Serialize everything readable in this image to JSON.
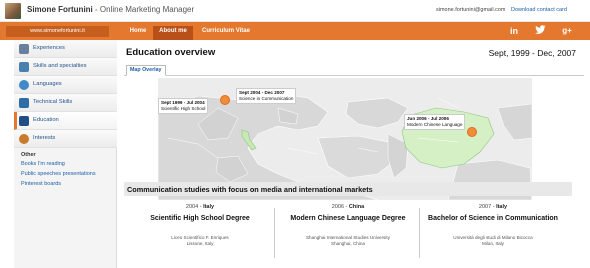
{
  "header": {
    "name": "Simone Fortunini",
    "separator": " - ",
    "role": "Online Marketing Manager",
    "email": "simone.fortunini@gmail.com",
    "download_link": "Download contact card"
  },
  "nav": {
    "url_label": "www.simonefortunini.it",
    "items": [
      {
        "label": "Home"
      },
      {
        "label": "About me"
      },
      {
        "label": "Curriculum Vitae"
      }
    ],
    "social": [
      {
        "label": "in",
        "icon": "linkedin-icon"
      },
      {
        "label": "t",
        "icon": "twitter-icon"
      },
      {
        "label": "g+",
        "icon": "google-plus-icon"
      }
    ],
    "accent": "#e5782f"
  },
  "sidebar": {
    "items": [
      {
        "label": "Experiences",
        "icon": "experiences-icon",
        "color": "#6a7f9b"
      },
      {
        "label": "Skills and specialties",
        "icon": "skills-icon",
        "color": "#4a7fb0"
      },
      {
        "label": "Languages",
        "icon": "languages-icon",
        "color": "#3f8ac7"
      },
      {
        "label": "Technical Skills",
        "icon": "technical-skills-icon",
        "color": "#2f6da8"
      },
      {
        "label": "Education",
        "icon": "education-icon",
        "color": "#1f4f86"
      },
      {
        "label": "Interests",
        "icon": "interests-icon",
        "color": "#c97b2b"
      }
    ],
    "other_title": "Other",
    "other_links": [
      {
        "label": "Books I'm reading"
      },
      {
        "label": "Public speeches presentations"
      },
      {
        "label": "Pinterest boards"
      }
    ]
  },
  "main": {
    "title": "Education overview",
    "date_range": "Sept, 1999 - Dec, 2007",
    "tab": "Map Overlay",
    "map": {
      "callouts": [
        {
          "dates": "Sept 1999 - Jul 2004",
          "desc": "Scientific High School"
        },
        {
          "dates": "Sept 2004 - Dec 2007",
          "desc": "Science in Communication"
        },
        {
          "dates": "Jun 2006 - Jul 2006",
          "desc": "Modern Chinese Language"
        }
      ]
    },
    "section_title": "Communication studies with focus on media and international markets",
    "education": [
      {
        "year": "2004",
        "country": "Italy",
        "degree": "Scientific High School Degree",
        "school": "Liceo Scientifico F. Enriques",
        "city": "Lissone, Italy"
      },
      {
        "year": "2006",
        "country": "China",
        "degree": "Modern Chinese Language Degree",
        "school": "Shanghai International Studies University",
        "city": "Shanghai, China"
      },
      {
        "year": "2007",
        "country": "Italy",
        "degree": "Bachelor of Science in Communication",
        "school": "Università degli studi di Milano Bicocca",
        "city": "Milan, Italy"
      }
    ]
  }
}
